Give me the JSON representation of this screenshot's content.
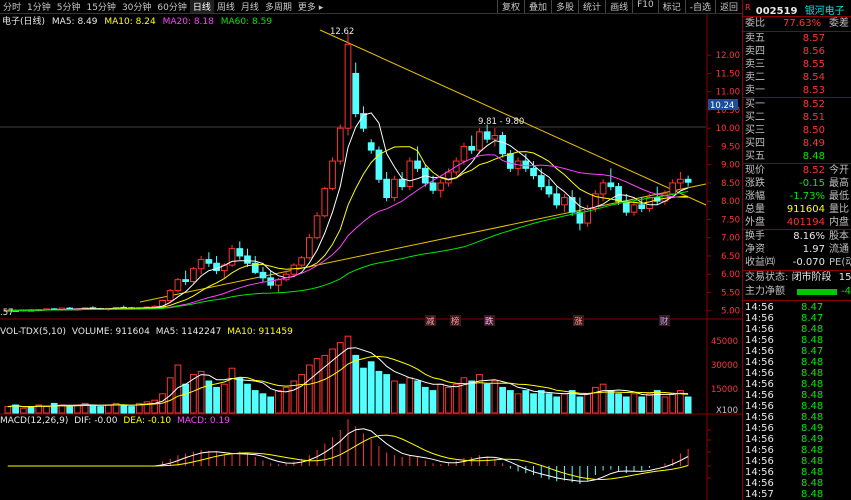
{
  "toolbar": {
    "periods": [
      "分时",
      "1分钟",
      "5分钟",
      "15分钟",
      "30分钟",
      "60分钟",
      "日线",
      "周线",
      "月线",
      "多周期",
      "更多 ▸"
    ],
    "active": "日线",
    "right_buttons": [
      "复权",
      "叠加",
      "多股",
      "统计",
      "画线",
      "F10",
      "标记",
      "-自选",
      "返回"
    ]
  },
  "main_header": {
    "name": "电子(日线)",
    "ma5": "MA5: 8.49",
    "ma10": "MA10: 8.24",
    "ma20": "MA20: 8.18",
    "ma60": "MA60: 8.59"
  },
  "annotations": {
    "high": "12.62",
    "range": "9.81 - 9.80",
    "low_left": ".57"
  },
  "price_axis": [
    "12.00",
    "11.50",
    "11.00",
    "10.50",
    "10.00",
    "9.50",
    "9.00",
    "8.50",
    "8.00",
    "7.50",
    "7.00",
    "6.50",
    "6.00",
    "5.50",
    "5.00"
  ],
  "price_marker": "10.24",
  "event_labels": [
    "减",
    "榜",
    "跌",
    "涨",
    "财"
  ],
  "vol_header": {
    "name": "VOL-TDX(5,10)",
    "volume": "VOLUME: 911604",
    "ma5": "MA5: 1142247",
    "ma10": "MA10: 911459"
  },
  "vol_axis": [
    "45000",
    "30000",
    "15000",
    "X100"
  ],
  "macd_header": {
    "name": "MACD(12,26,9)",
    "dif": "DIF: -0.00",
    "dea": "DEA: -0.10",
    "macd": "MACD: 0.19"
  },
  "side": {
    "code": "002519",
    "name": "银河电子",
    "badge": "R",
    "weibi": {
      "label": "委比",
      "value": "77.63%",
      "extra": "委差"
    },
    "asks": [
      {
        "label": "卖五",
        "price": "8.57"
      },
      {
        "label": "卖四",
        "price": "8.56"
      },
      {
        "label": "卖三",
        "price": "8.55"
      },
      {
        "label": "卖二",
        "price": "8.54"
      },
      {
        "label": "卖一",
        "price": "8.53"
      }
    ],
    "bids": [
      {
        "label": "买一",
        "price": "8.52"
      },
      {
        "label": "买二",
        "price": "8.51"
      },
      {
        "label": "买三",
        "price": "8.50"
      },
      {
        "label": "买四",
        "price": "8.49"
      },
      {
        "label": "买五",
        "price": "8.48"
      }
    ],
    "quote": [
      {
        "label": "现价",
        "value": "8.52",
        "extra": "今开",
        "cls": "r"
      },
      {
        "label": "涨跌",
        "value": "-0.15",
        "extra": "最高",
        "cls": "g"
      },
      {
        "label": "涨幅",
        "value": "-1.73%",
        "extra": "最低",
        "cls": "g"
      },
      {
        "label": "总量",
        "value": "911604",
        "extra": "量比",
        "cls": "y"
      },
      {
        "label": "外盘",
        "value": "401194",
        "extra": "内盘",
        "cls": "r"
      }
    ],
    "fund": [
      {
        "label": "换手",
        "value": "8.16%",
        "extra": "股本"
      },
      {
        "label": "净资",
        "value": "1.97",
        "extra": "流通"
      },
      {
        "label": "收益㈣",
        "value": "-0.070",
        "extra": "PE(动"
      }
    ],
    "status": {
      "label": "交易状态:",
      "value": "闭市阶段",
      "extra": "15"
    },
    "main_net": {
      "label": "主力净额",
      "value": "-4"
    },
    "ticks": [
      {
        "time": "14:56",
        "price": "8.47"
      },
      {
        "time": "14:56",
        "price": "8.47"
      },
      {
        "time": "14:56",
        "price": "8.48"
      },
      {
        "time": "14:56",
        "price": "8.48"
      },
      {
        "time": "14:56",
        "price": "8.47"
      },
      {
        "time": "14:56",
        "price": "8.48"
      },
      {
        "time": "14:56",
        "price": "8.48"
      },
      {
        "time": "14:56",
        "price": "8.48"
      },
      {
        "time": "14:56",
        "price": "8.48"
      },
      {
        "time": "14:56",
        "price": "8.48"
      },
      {
        "time": "14:56",
        "price": "8.48"
      },
      {
        "time": "14:56",
        "price": "8.49"
      },
      {
        "time": "14:56",
        "price": "8.49"
      },
      {
        "time": "14:56",
        "price": "8.48"
      },
      {
        "time": "14:56",
        "price": "8.48"
      },
      {
        "time": "14:56",
        "price": "8.48"
      },
      {
        "time": "14:56",
        "price": "8.48"
      },
      {
        "time": "14:57",
        "price": "8.48"
      }
    ]
  },
  "chart_data": {
    "type": "candlestick",
    "prices": [
      [
        5.0,
        5.02,
        4.98,
        5.01
      ],
      [
        5.01,
        5.03,
        4.99,
        5.0
      ],
      [
        5.0,
        5.02,
        4.97,
        5.02
      ],
      [
        5.02,
        5.04,
        4.99,
        5.0
      ],
      [
        5.0,
        5.03,
        4.98,
        5.03
      ],
      [
        5.03,
        5.06,
        5.0,
        5.05
      ],
      [
        5.05,
        5.07,
        5.01,
        5.02
      ],
      [
        5.02,
        5.08,
        5.0,
        5.07
      ],
      [
        5.07,
        5.1,
        5.03,
        5.04
      ],
      [
        5.04,
        5.06,
        5.0,
        5.05
      ],
      [
        5.05,
        5.09,
        5.03,
        5.08
      ],
      [
        5.08,
        5.12,
        5.05,
        5.06
      ],
      [
        5.06,
        5.08,
        5.02,
        5.04
      ],
      [
        5.04,
        5.07,
        5.0,
        5.06
      ],
      [
        5.06,
        5.1,
        5.04,
        5.09
      ],
      [
        5.09,
        5.14,
        5.06,
        5.08
      ],
      [
        5.08,
        5.1,
        5.03,
        5.05
      ],
      [
        5.05,
        5.09,
        5.02,
        5.08
      ],
      [
        5.08,
        5.12,
        5.05,
        5.1
      ],
      [
        5.1,
        5.15,
        5.07,
        5.12
      ],
      [
        5.12,
        5.3,
        5.1,
        5.28
      ],
      [
        5.28,
        5.6,
        5.25,
        5.55
      ],
      [
        5.55,
        5.9,
        5.5,
        5.85
      ],
      [
        5.85,
        6.1,
        5.7,
        5.8
      ],
      [
        5.8,
        6.2,
        5.75,
        6.15
      ],
      [
        6.15,
        6.5,
        6.0,
        6.4
      ],
      [
        6.4,
        6.6,
        6.2,
        6.3
      ],
      [
        6.3,
        6.5,
        6.0,
        6.1
      ],
      [
        6.1,
        6.3,
        5.9,
        6.25
      ],
      [
        6.25,
        6.8,
        6.2,
        6.7
      ],
      [
        6.7,
        6.9,
        6.4,
        6.5
      ],
      [
        6.5,
        6.7,
        6.2,
        6.3
      ],
      [
        6.3,
        6.5,
        6.0,
        6.05
      ],
      [
        6.05,
        6.2,
        5.8,
        5.9
      ],
      [
        5.9,
        6.1,
        5.6,
        5.7
      ],
      [
        5.7,
        5.9,
        5.5,
        5.85
      ],
      [
        5.85,
        6.1,
        5.8,
        6.0
      ],
      [
        6.0,
        6.3,
        5.95,
        6.25
      ],
      [
        6.25,
        6.5,
        6.2,
        6.45
      ],
      [
        6.45,
        7.1,
        6.4,
        7.0
      ],
      [
        7.0,
        7.7,
        6.95,
        7.6
      ],
      [
        7.6,
        8.4,
        7.55,
        8.35
      ],
      [
        8.35,
        9.2,
        8.3,
        9.1
      ],
      [
        9.1,
        10.1,
        9.0,
        10.0
      ],
      [
        10.0,
        12.62,
        9.8,
        12.3
      ],
      [
        11.5,
        11.8,
        10.3,
        10.4
      ],
      [
        10.4,
        10.6,
        9.9,
        10.0
      ],
      [
        9.6,
        9.7,
        9.3,
        9.4
      ],
      [
        9.4,
        9.5,
        8.5,
        8.6
      ],
      [
        8.6,
        8.8,
        8.0,
        8.1
      ],
      [
        8.1,
        8.7,
        8.0,
        8.6
      ],
      [
        8.6,
        8.8,
        8.3,
        8.4
      ],
      [
        8.4,
        9.2,
        8.3,
        9.1
      ],
      [
        9.1,
        9.5,
        8.8,
        8.9
      ],
      [
        8.9,
        9.0,
        8.4,
        8.5
      ],
      [
        8.5,
        8.7,
        8.2,
        8.3
      ],
      [
        8.3,
        8.6,
        8.1,
        8.5
      ],
      [
        8.5,
        8.9,
        8.4,
        8.8
      ],
      [
        8.8,
        9.2,
        8.7,
        9.1
      ],
      [
        9.1,
        9.6,
        9.0,
        9.5
      ],
      [
        9.5,
        9.8,
        9.3,
        9.4
      ],
      [
        9.4,
        10.0,
        9.3,
        9.9
      ],
      [
        9.9,
        10.1,
        9.6,
        9.7
      ],
      [
        9.7,
        10.0,
        9.5,
        9.8
      ],
      [
        9.8,
        9.9,
        9.2,
        9.3
      ],
      [
        9.3,
        9.4,
        8.8,
        8.9
      ],
      [
        8.9,
        9.2,
        8.7,
        9.1
      ],
      [
        9.1,
        9.3,
        8.8,
        8.9
      ],
      [
        8.9,
        9.1,
        8.6,
        8.7
      ],
      [
        8.7,
        8.9,
        8.3,
        8.4
      ],
      [
        8.4,
        8.6,
        8.1,
        8.2
      ],
      [
        8.2,
        8.4,
        7.8,
        7.9
      ],
      [
        7.9,
        8.2,
        7.7,
        8.1
      ],
      [
        8.1,
        8.3,
        7.6,
        7.7
      ],
      [
        7.7,
        8.1,
        7.2,
        7.4
      ],
      [
        7.4,
        7.9,
        7.3,
        7.8
      ],
      [
        7.8,
        8.3,
        7.7,
        8.2
      ],
      [
        8.2,
        8.6,
        8.0,
        8.5
      ],
      [
        8.5,
        8.9,
        8.3,
        8.4
      ],
      [
        8.4,
        8.5,
        7.9,
        8.0
      ],
      [
        8.0,
        8.2,
        7.6,
        7.7
      ],
      [
        7.7,
        8.0,
        7.6,
        7.9
      ],
      [
        7.9,
        8.1,
        7.7,
        7.8
      ],
      [
        7.8,
        8.2,
        7.7,
        8.1
      ],
      [
        8.1,
        8.4,
        7.9,
        8.0
      ],
      [
        8.0,
        8.3,
        7.9,
        8.2
      ],
      [
        8.2,
        8.6,
        8.1,
        8.5
      ],
      [
        8.5,
        8.8,
        8.3,
        8.6
      ],
      [
        8.6,
        8.7,
        8.4,
        8.52
      ]
    ],
    "volumes": [
      4,
      5,
      3,
      4,
      5,
      4,
      6,
      5,
      4,
      5,
      6,
      5,
      4,
      5,
      6,
      5,
      4,
      6,
      7,
      8,
      12,
      22,
      30,
      18,
      24,
      26,
      20,
      16,
      18,
      28,
      22,
      18,
      14,
      12,
      10,
      14,
      16,
      20,
      24,
      30,
      34,
      36,
      40,
      44,
      48,
      36,
      28,
      32,
      26,
      24,
      20,
      18,
      22,
      20,
      16,
      14,
      18,
      16,
      18,
      22,
      20,
      24,
      18,
      20,
      16,
      14,
      12,
      14,
      12,
      14,
      12,
      10,
      12,
      14,
      10,
      12,
      16,
      18,
      14,
      12,
      10,
      12,
      10,
      12,
      14,
      10,
      12,
      14,
      10
    ],
    "macd": [
      0,
      0,
      0,
      0,
      0,
      0,
      0,
      0,
      0,
      0,
      0,
      0,
      0,
      0,
      0,
      0,
      0,
      0,
      0,
      0,
      0.05,
      0.08,
      0.12,
      0.14,
      0.16,
      0.18,
      0.17,
      0.15,
      0.12,
      0.14,
      0.16,
      0.13,
      0.1,
      0.06,
      0.03,
      0.02,
      0.03,
      0.05,
      0.08,
      0.12,
      0.18,
      0.25,
      0.32,
      0.4,
      0.52,
      0.44,
      0.36,
      0.3,
      0.22,
      0.15,
      0.12,
      0.1,
      0.12,
      0.1,
      0.06,
      0.03,
      0.02,
      0.04,
      0.06,
      0.09,
      0.1,
      0.12,
      0.1,
      0.08,
      0.03,
      -0.03,
      -0.06,
      -0.08,
      -0.1,
      -0.13,
      -0.15,
      -0.17,
      -0.16,
      -0.18,
      -0.2,
      -0.16,
      -0.1,
      -0.05,
      -0.04,
      -0.06,
      -0.08,
      -0.06,
      -0.05,
      -0.02,
      0.0,
      0.03,
      0.08,
      0.14,
      0.19
    ]
  }
}
